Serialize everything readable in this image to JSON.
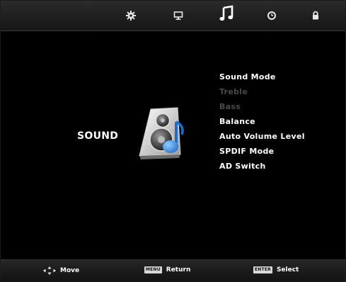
{
  "tabs": [
    {
      "icon": "picture-gear-icon"
    },
    {
      "icon": "monitor-icon"
    },
    {
      "icon": "music-note-icon",
      "active": true
    },
    {
      "icon": "clock-icon"
    },
    {
      "icon": "lock-icon"
    }
  ],
  "page": {
    "title": "SOUND"
  },
  "menu": {
    "items": [
      {
        "label": "Sound Mode",
        "enabled": true
      },
      {
        "label": "Treble",
        "enabled": false
      },
      {
        "label": "Bass",
        "enabled": false
      },
      {
        "label": "Balance",
        "enabled": true
      },
      {
        "label": "Auto Volume Level",
        "enabled": true
      },
      {
        "label": "SPDIF Mode",
        "enabled": true
      },
      {
        "label": "AD Switch",
        "enabled": true
      }
    ]
  },
  "footer": {
    "move_label": "Move",
    "menu_key": "MENU",
    "return_label": "Return",
    "enter_key": "ENTER",
    "select_label": "Select"
  },
  "colors": {
    "text_enabled": "#ffffff",
    "text_disabled": "#4a4a4a",
    "accent_note": "#2f7fd6"
  }
}
